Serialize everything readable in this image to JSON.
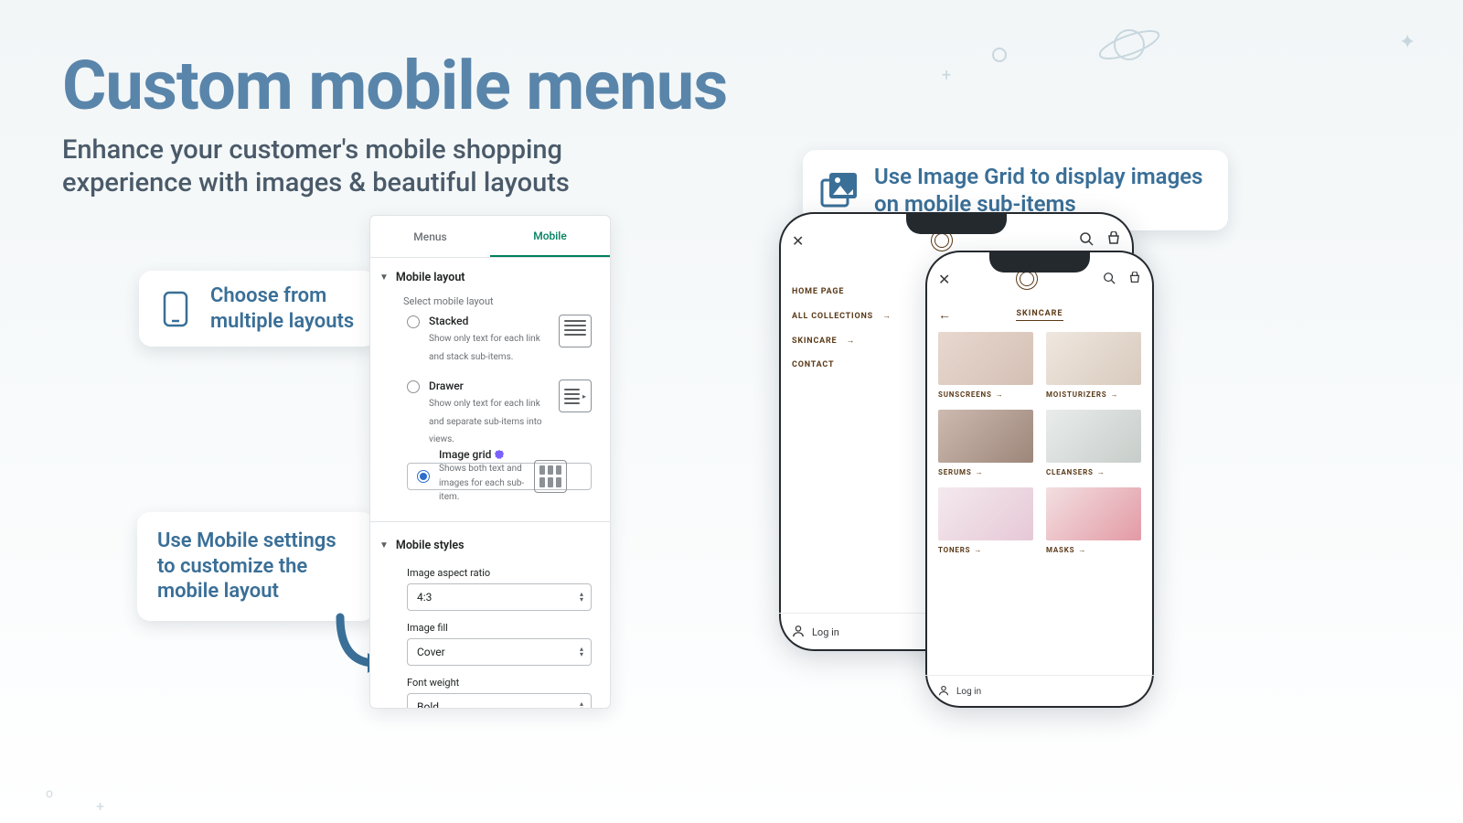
{
  "headline": {
    "title": "Custom mobile menus",
    "subtitle": "Enhance your customer's mobile shopping experience with images & beautiful layouts"
  },
  "callouts": {
    "layouts": "Choose from multiple layouts",
    "settings": "Use Mobile settings to customize the mobile layout",
    "imagegrid": "Use Image Grid to display images on mobile sub-items"
  },
  "panel": {
    "tabs": {
      "menus": "Menus",
      "mobile": "Mobile"
    },
    "section_layout": "Mobile layout",
    "select_label": "Select mobile layout",
    "options": [
      {
        "id": "stacked",
        "name": "Stacked",
        "desc": "Show only text for each link and stack sub-items."
      },
      {
        "id": "drawer",
        "name": "Drawer",
        "desc": "Show only text for each link and separate sub-items into views."
      },
      {
        "id": "imagegrid",
        "name": "Image grid",
        "desc": "Shows both text and images for each sub-item."
      }
    ],
    "selected": "imagegrid",
    "section_styles": "Mobile styles",
    "fields": {
      "aspect": {
        "label": "Image aspect ratio",
        "value": "4:3"
      },
      "fill": {
        "label": "Image fill",
        "value": "Cover"
      },
      "weight": {
        "label": "Font weight",
        "value": "Bold"
      }
    }
  },
  "phone_back": {
    "nav": [
      "HOME PAGE",
      "ALL COLLECTIONS",
      "SKINCARE",
      "CONTACT"
    ],
    "login": "Log in"
  },
  "phone_front": {
    "crumb": "SKINCARE",
    "cards": [
      "SUNSCREENS",
      "MOISTURIZERS",
      "SERUMS",
      "CLEANSERS",
      "TONERS",
      "MASKS"
    ],
    "login": "Log in"
  },
  "colors": {
    "accent": "#3a6f97",
    "heading": "#5a85aa",
    "shopify_green": "#008060",
    "brand_brown": "#5a3a18"
  }
}
